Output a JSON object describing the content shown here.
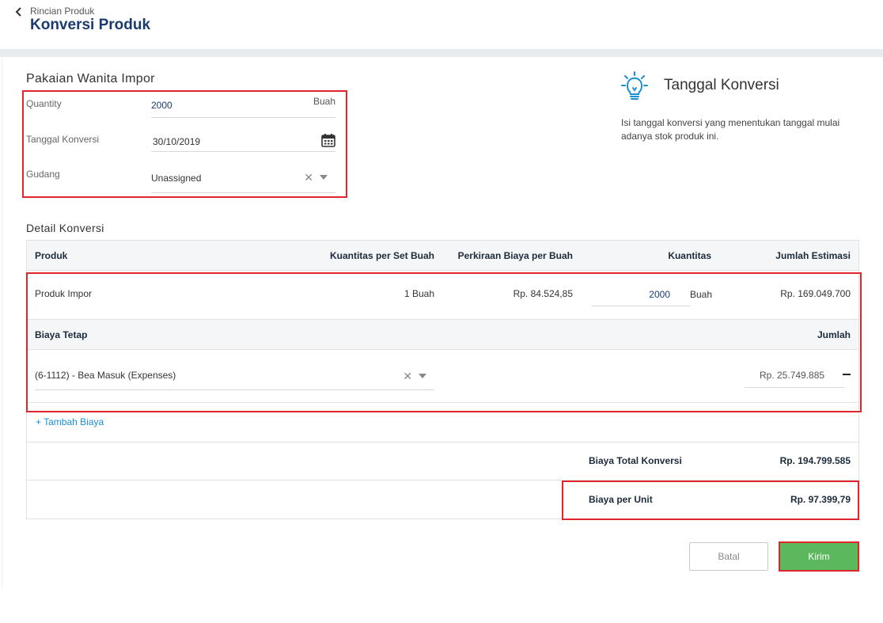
{
  "header": {
    "breadcrumb": "Rincian Produk",
    "title": "Konversi Produk"
  },
  "form": {
    "product_name": "Pakaian Wanita Impor",
    "quantity_label": "Quantity",
    "quantity_value": "2000",
    "quantity_unit": "Buah",
    "date_label": "Tanggal Konversi",
    "date_value": "30/10/2019",
    "warehouse_label": "Gudang",
    "warehouse_value": "Unassigned"
  },
  "tip": {
    "title": "Tanggal Konversi",
    "text": "Isi tanggal konversi yang menentukan tanggal mulai adanya stok produk ini."
  },
  "detail": {
    "title": "Detail Konversi",
    "columns": [
      "Produk",
      "Kuantitas per Set Buah",
      "Perkiraan Biaya per Buah",
      "Kuantitas",
      "Jumlah Estimasi"
    ],
    "rows": [
      {
        "product": "Produk Impor",
        "qty_per_set": "1 Buah",
        "cost_per_unit": "Rp. 84.524,85",
        "qty": "2000",
        "qty_unit": "Buah",
        "estimate": "Rp. 169.049.700"
      }
    ],
    "fixed_cost_header": "Biaya Tetap",
    "fixed_cost_amount_header": "Jumlah",
    "fixed_costs": [
      {
        "account": "(6-1112) - Bea Masuk (Expenses)",
        "amount": "Rp. 25.749.885"
      }
    ],
    "add_cost": "+ Tambah Biaya",
    "total_label": "Biaya Total Konversi",
    "total_value": "Rp. 194.799.585",
    "per_unit_label": "Biaya per Unit",
    "per_unit_value": "Rp. 97.399,79"
  },
  "actions": {
    "cancel": "Batal",
    "submit": "Kirim"
  },
  "colors": {
    "title": "#1a3b6e",
    "submit": "#5cb85c",
    "highlight": "#e0252c",
    "link": "#1a8fd6"
  }
}
